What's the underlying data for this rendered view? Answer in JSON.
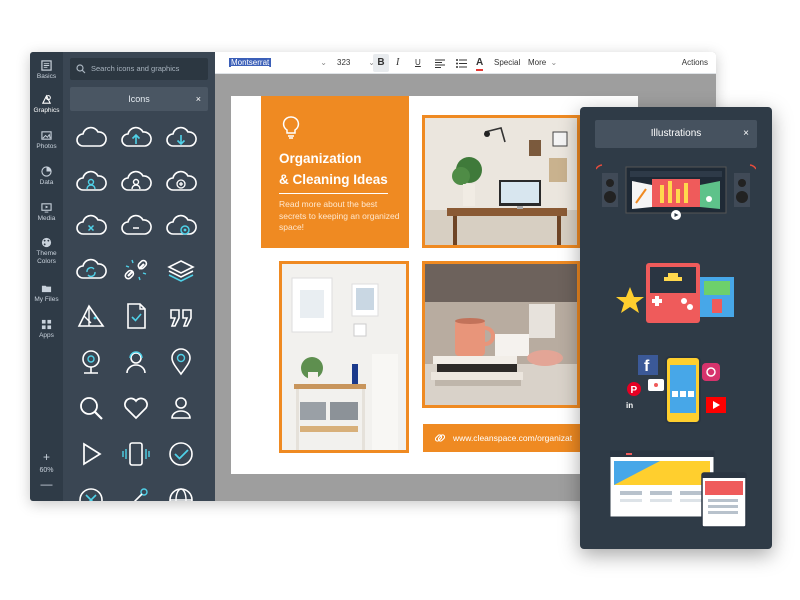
{
  "rail": {
    "items": [
      {
        "label": "Basics",
        "icon": "basics-icon"
      },
      {
        "label": "Graphics",
        "icon": "graphics-icon"
      },
      {
        "label": "Photos",
        "icon": "photos-icon"
      },
      {
        "label": "Data",
        "icon": "data-icon"
      },
      {
        "label": "Media",
        "icon": "media-icon"
      },
      {
        "label": "Theme Colors",
        "icon": "palette-icon"
      },
      {
        "label": "My Files",
        "icon": "folder-icon"
      },
      {
        "label": "Apps",
        "icon": "apps-icon"
      }
    ],
    "zoom_in": "+",
    "zoom_value": "60%",
    "zoom_out": "—"
  },
  "panel": {
    "search_placeholder": "Search icons and graphics",
    "tab_label": "Icons",
    "close": "×"
  },
  "toolbar": {
    "font": "Montserrat",
    "size": "323",
    "bold": "B",
    "italic": "I",
    "underline": "U",
    "color_letter": "A",
    "special": "Special",
    "more": "More",
    "actions": "Actions",
    "chevron": "⌄"
  },
  "document": {
    "title_line1": "Organization",
    "title_line2": "& Cleaning Ideas",
    "subtitle": "Read more about the best secrets to keeping an organized space!",
    "url": "www.cleanspace.com/organizat",
    "accent": "#ef8a22"
  },
  "illustrations": {
    "title": "Illustrations",
    "close": "×"
  }
}
